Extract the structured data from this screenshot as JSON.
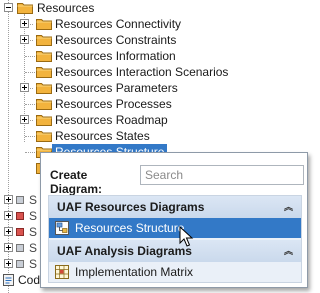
{
  "tree": {
    "root_label": "Resources",
    "items": [
      {
        "label": "Resources Connectivity",
        "expander": "plus"
      },
      {
        "label": "Resources Constraints",
        "expander": "plus"
      },
      {
        "label": "Resources Information",
        "expander": "none"
      },
      {
        "label": "Resources Interaction Scenarios",
        "expander": "none"
      },
      {
        "label": "Resources Parameters",
        "expander": "plus"
      },
      {
        "label": "Resources Processes",
        "expander": "none"
      },
      {
        "label": "Resources Roadmap",
        "expander": "plus"
      },
      {
        "label": "Resources States",
        "expander": "none"
      },
      {
        "label": "Resources Structure",
        "expander": "none",
        "selected": true
      }
    ],
    "hidden_items": [
      {
        "label": "S",
        "expander": "plus"
      },
      {
        "label": "S",
        "expander": "plus"
      },
      {
        "label": "S",
        "expander": "plus"
      },
      {
        "label": "S",
        "expander": "plus"
      },
      {
        "label": "S",
        "expander": "plus"
      }
    ],
    "bottom_item_label": "Code"
  },
  "popup": {
    "create_label": "Create Diagram:",
    "search_placeholder": "Search",
    "groups": [
      {
        "title": "UAF Resources Diagrams",
        "chevron": "⌃⌃",
        "items": [
          {
            "label": "Resources Structure",
            "selected": true
          }
        ]
      },
      {
        "title": "UAF Analysis Diagrams",
        "chevron": "⌃⌃",
        "items": [
          {
            "label": "Implementation Matrix",
            "selected": false
          }
        ]
      }
    ]
  },
  "colors": {
    "selection": "#3379c7",
    "folder": "#f2b33d",
    "group_header": "#d3e0f0"
  }
}
